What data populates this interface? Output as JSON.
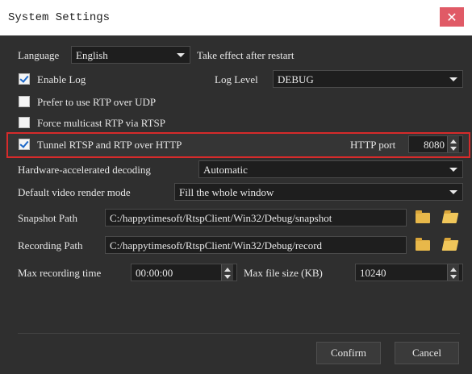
{
  "window": {
    "title": "System Settings"
  },
  "language": {
    "label": "Language",
    "value": "English",
    "note": "Take effect after restart"
  },
  "enable_log": {
    "label": "Enable Log",
    "checked": true
  },
  "log_level": {
    "label": "Log Level",
    "value": "DEBUG"
  },
  "prefer_rtp_udp": {
    "label": "Prefer to use RTP over UDP",
    "checked": false
  },
  "force_multicast": {
    "label": "Force multicast RTP via RTSP",
    "checked": false
  },
  "tunnel": {
    "label": "Tunnel RTSP and RTP over HTTP",
    "checked": true
  },
  "http_port": {
    "label": "HTTP port",
    "value": "8080"
  },
  "hw_decoding": {
    "label": "Hardware-accelerated decoding",
    "value": "Automatic"
  },
  "render_mode": {
    "label": "Default video render mode",
    "value": "Fill the whole window"
  },
  "snapshot": {
    "label": "Snapshot Path",
    "value": "C:/happytimesoft/RtspClient/Win32/Debug/snapshot"
  },
  "recording": {
    "label": "Recording Path",
    "value": "C:/happytimesoft/RtspClient/Win32/Debug/record"
  },
  "max_rec_time": {
    "label": "Max recording time",
    "value": "00:00:00"
  },
  "max_file_size": {
    "label": "Max file size (KB)",
    "value": "10240"
  },
  "buttons": {
    "confirm": "Confirm",
    "cancel": "Cancel"
  },
  "colors": {
    "highlight_border": "#d62b2b",
    "close_button": "#e05a66",
    "folder": "#e8b84a"
  }
}
